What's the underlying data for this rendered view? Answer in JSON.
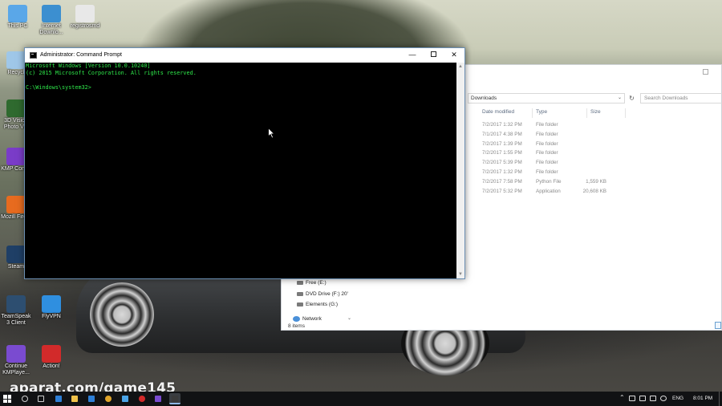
{
  "desktop": {
    "icons": [
      {
        "label": "This PC",
        "icon": "this-pc-icon",
        "color": "#5aa7e8"
      },
      {
        "label": "Internet Downlo...",
        "icon": "internet-download-manager-icon",
        "color": "#3c8fd0"
      },
      {
        "label": "registrosmd",
        "icon": "registry-file-icon",
        "color": "#e8e8e8"
      },
      {
        "label": "Recycl",
        "icon": "recycle-bin-icon",
        "color": "#9fc7e8"
      },
      {
        "label": "3D Vision Photo Vie",
        "icon": "3d-vision-icon",
        "color": "#2f6a2f"
      },
      {
        "label": "KMP Conne",
        "icon": "kmp-connect-icon",
        "color": "#7a3cc8"
      },
      {
        "label": "Mozill Firefo",
        "icon": "firefox-icon",
        "color": "#e76b1f"
      },
      {
        "label": "Steam",
        "icon": "steam-icon",
        "color": "#1f3f66"
      },
      {
        "label": "TeamSpeak 3 Client",
        "icon": "teamspeak-icon",
        "color": "#2d4e70"
      },
      {
        "label": "FlyVPN",
        "icon": "flyvpn-icon",
        "color": "#2f8fe0"
      },
      {
        "label": "Continue KMPlaye...",
        "icon": "kmplayer-icon",
        "color": "#7a4bd0"
      },
      {
        "label": "Action!",
        "icon": "action-icon",
        "color": "#d22a2a"
      }
    ]
  },
  "cmd": {
    "title": "Administrator: Command Prompt",
    "minimize": "—",
    "close": "✕",
    "lines": [
      "Microsoft Windows [Version 10.0.10240]",
      "(c) 2015 Microsoft Corporation. All rights reserved.",
      "",
      "C:\\Windows\\system32>"
    ],
    "text_color": "#2ee84a"
  },
  "explorer": {
    "address": "Downloads",
    "search_placeholder": "Search Downloads",
    "columns": {
      "date": "Date modified",
      "type": "Type",
      "size": "Size"
    },
    "rows": [
      {
        "date": "7/2/2017 1:32 PM",
        "type": "File folder",
        "size": ""
      },
      {
        "date": "7/1/2017 4:38 PM",
        "type": "File folder",
        "size": ""
      },
      {
        "date": "7/2/2017 1:39 PM",
        "type": "File folder",
        "size": ""
      },
      {
        "date": "7/2/2017 1:55 PM",
        "type": "File folder",
        "size": ""
      },
      {
        "date": "7/2/2017 5:39 PM",
        "type": "File folder",
        "size": ""
      },
      {
        "date": "7/2/2017 1:32 PM",
        "type": "File folder",
        "size": ""
      },
      {
        "date": "7/2/2017 7:58 PM",
        "type": "Python File",
        "size": "1,559 KB"
      },
      {
        "date": "7/2/2017 5:32 PM",
        "type": "Application",
        "size": "20,608 KB"
      }
    ],
    "nav": [
      {
        "label": "Free (E:)"
      },
      {
        "label": "DVD Drive (F:) 20'"
      },
      {
        "label": "Elements (G:)"
      },
      {
        "label": "Network"
      }
    ],
    "status": "8 items"
  },
  "watermark": "aparat.com/game145",
  "taskbar": {
    "items": [
      {
        "icon": "search-icon",
        "color": "#cfcfcf"
      },
      {
        "icon": "task-view-icon",
        "color": "#cfcfcf"
      },
      {
        "icon": "edge-icon",
        "color": "#2e7fd6"
      },
      {
        "icon": "file-explorer-icon",
        "color": "#f0c24a"
      },
      {
        "icon": "store-icon",
        "color": "#2e7fd6"
      },
      {
        "icon": "chrome-icon",
        "color": "#e0a52b"
      },
      {
        "icon": "flyvpn-icon",
        "color": "#4aa3e6"
      },
      {
        "icon": "action-icon",
        "color": "#d22a2a"
      },
      {
        "icon": "kmplayer-icon",
        "color": "#7a4bd0"
      },
      {
        "icon": "command-prompt-icon",
        "color": "#3a3a3a"
      }
    ],
    "language": "ENG",
    "time": "8:01 PM"
  }
}
